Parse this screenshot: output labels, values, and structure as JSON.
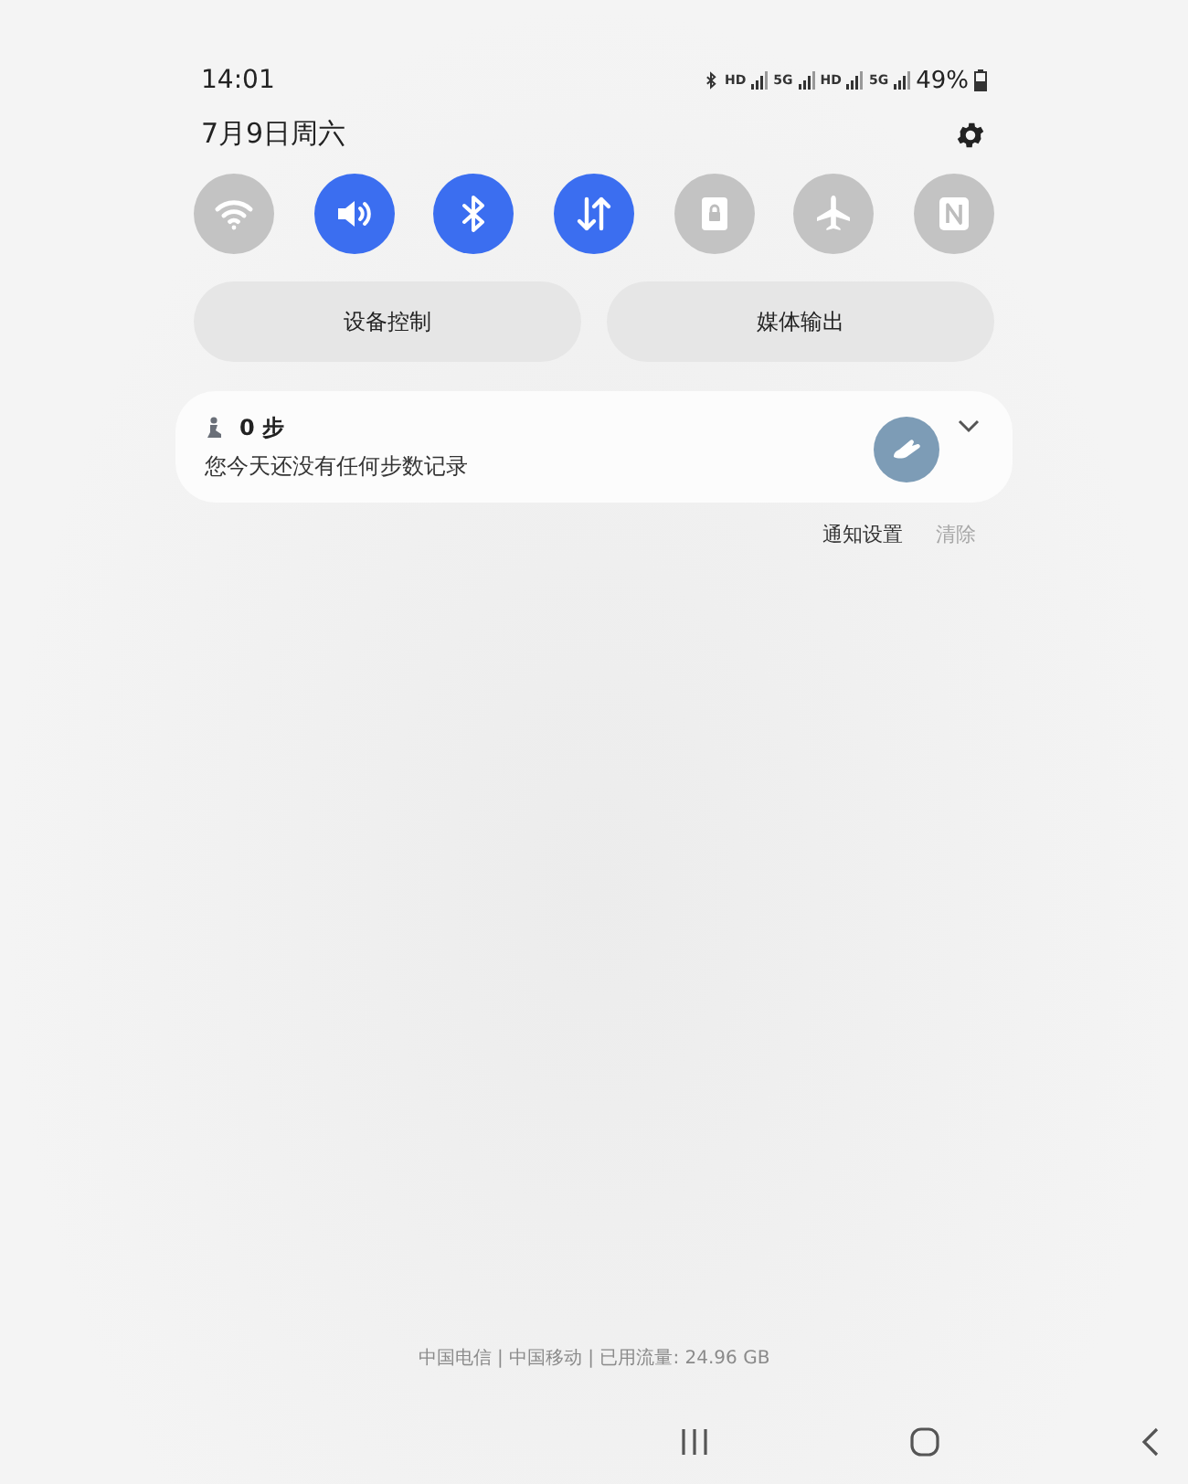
{
  "status_bar": {
    "time": "14:01",
    "indicators": [
      {
        "kind": "text",
        "text": "HD"
      },
      {
        "kind": "text",
        "text": "5G"
      },
      {
        "kind": "text",
        "text": "HD"
      },
      {
        "kind": "text",
        "text": "5G"
      }
    ],
    "battery": "49%"
  },
  "header": {
    "date": "7月9日周六"
  },
  "quick_tiles": [
    {
      "kind": "wifi",
      "on": false
    },
    {
      "kind": "sound",
      "on": true
    },
    {
      "kind": "bluetooth",
      "on": true
    },
    {
      "kind": "data",
      "on": true
    },
    {
      "kind": "lock",
      "on": false
    },
    {
      "kind": "airplane",
      "on": false
    },
    {
      "kind": "nfc",
      "on": false
    }
  ],
  "buttons": [
    "设备控制",
    "媒体输出"
  ],
  "notification": {
    "title": "0 步",
    "text": "您今天还没有任何步数记录"
  },
  "notification_actions": [
    {
      "label": "通知设置",
      "disabled": false
    },
    {
      "label": "清除",
      "disabled": true
    }
  ],
  "footer": "中国电信 | 中国移动 | 已用流量: 24.96 GB"
}
